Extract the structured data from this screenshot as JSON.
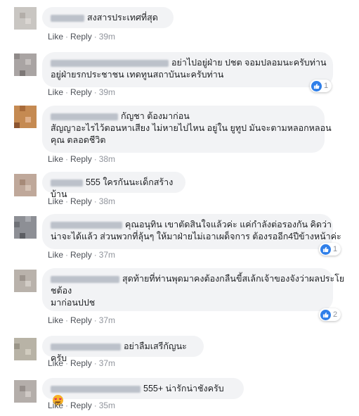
{
  "labels": {
    "like": "Like",
    "reply": "Reply",
    "dot": "·"
  },
  "colors": {
    "bubble": "#f2f3f5",
    "link": "#4b4f56",
    "meta": "#90949c",
    "like_blue": "#2f7fe9"
  },
  "comments": [
    {
      "lines": [
        "สงสารประเทศที่สุด"
      ],
      "time": "39m",
      "reactions": null
    },
    {
      "lines": [
        "อย่าไปอยู่ฝ่าย ปชต จอมปลอมนะครับท่าน",
        "อยู่ฝ่ายรกประชาชน เทดทูนสถาบันนะครับท่าน"
      ],
      "time": "39m",
      "reactions": {
        "icon": "like-icon",
        "count": "1"
      }
    },
    {
      "lines": [
        "กัญชา ต้องมาก่อน",
        "สัญญาอะไรไว้ตอนหาเสียง ไม่หายไปไหน อยู่ใน ยูทูป มันจะตามหลอกหลอน",
        "คุณ ตลอดชีวิต"
      ],
      "time": "38m",
      "reactions": null
    },
    {
      "lines": [
        "555 ใครกันนะเด็กสร้างบ้าน"
      ],
      "time": "38m",
      "reactions": null
    },
    {
      "lines": [
        "คุณอนุทิน เขาตัดสินใจแล้วค่ะ แค่กำลังต่อรองกัน คิดว่า",
        "น่าจะได้แล้ว ส่วนพวกที่ลุ้นๆ ให้มาฝ่ายไม่เอาเผด็จการ ต้องรออีก4ปีข้างหน้าค่ะ"
      ],
      "time": "37m",
      "reactions": {
        "icon": "like-icon",
        "count": "1"
      }
    },
    {
      "lines": [
        "สุดท้ายที่ท่านพุดมาคงต้องกลืนขี้สเล้กเจ้าของจังว่าผลประโย",
        "ชต้อง",
        "มาก่อนปปช"
      ],
      "time": "37m",
      "reactions": {
        "icon": "like-icon",
        "count": "2"
      }
    },
    {
      "lines": [
        "อย่าลืมเสรีกัญนะครับ"
      ],
      "time": "37m",
      "reactions": null
    },
    {
      "lines": [
        "555+ น่ารักน่าชังครับ"
      ],
      "time": "35m",
      "reactions": null,
      "emoji": "heart-eyes-emoji"
    }
  ]
}
